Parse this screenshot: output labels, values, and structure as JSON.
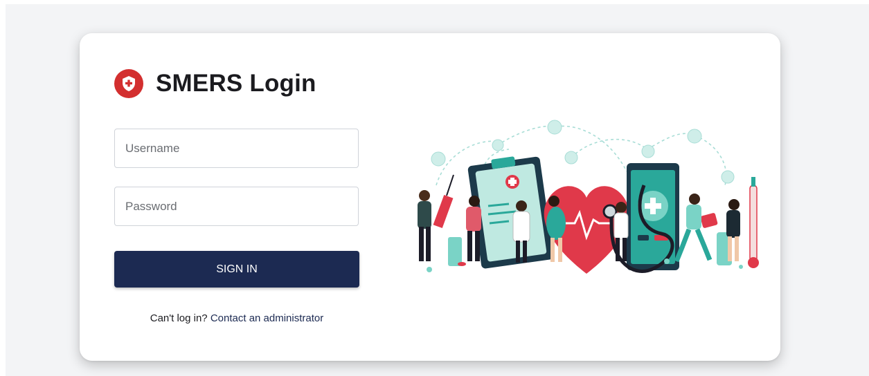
{
  "login": {
    "title": "SMERS Login",
    "username_placeholder": "Username",
    "password_placeholder": "Password",
    "signin_label": "SIGN IN",
    "help_text": "Can't log in?",
    "help_link": "Contact an administrator"
  },
  "icons": {
    "logo": "shield-cross-icon",
    "illustration": "healthcare-workers-illustration"
  },
  "colors": {
    "brand_red": "#d32f2f",
    "button_navy": "#1c2a52",
    "heart_red": "#e0394a",
    "teal": "#2aa89a",
    "page_bg": "#f3f4f6"
  }
}
